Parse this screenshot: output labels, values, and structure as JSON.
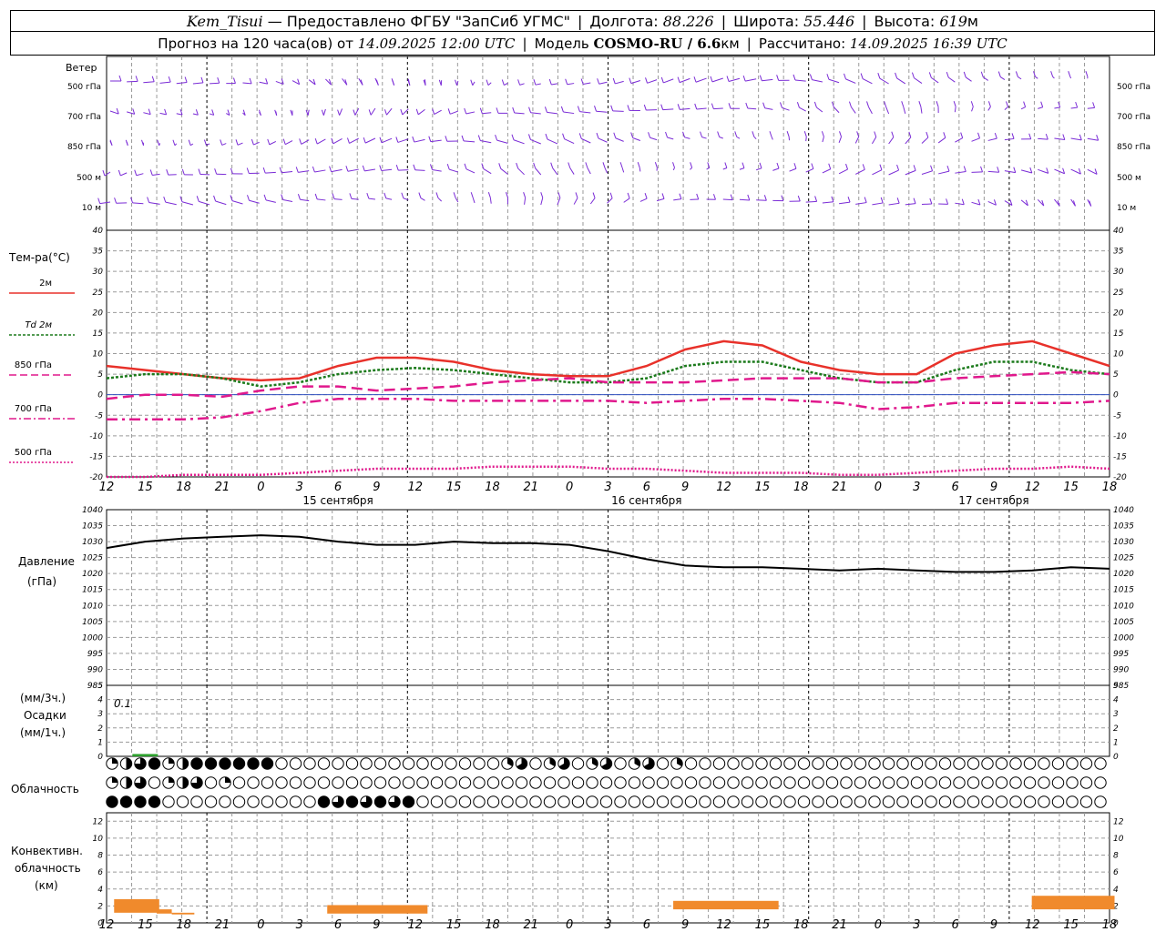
{
  "header": {
    "station": "Kem_Tisui",
    "provider": "— Предоставлено ФГБУ \"ЗапСиб УГМС\"",
    "lon_label": "Долгота:",
    "lon_value": "88.226",
    "lat_label": "Широта:",
    "lat_value": "55.446",
    "alt_label": "Высота:",
    "alt_value": "619",
    "alt_unit": "м",
    "forecast_prefix": "Прогноз на 120 часа(ов) от",
    "forecast_time": "14.09.2025 12:00 UTC",
    "model_label": "Модель",
    "model_name": "COSMO-RU / 6.6",
    "model_unit": "км",
    "calc_label": "Рассчитано:",
    "calc_time": "14.09.2025 16:39 UTC"
  },
  "wind_panel": {
    "title": "Ветер",
    "levels": [
      "500 гПа",
      "700 гПа",
      "850 гПа",
      "500 м",
      "10 м"
    ],
    "colors": {
      "barb": "#7a2bd6"
    }
  },
  "temp_panel": {
    "title": "Тем-ра(°С)",
    "legend": [
      "2м",
      "Td 2м",
      "850 гПа",
      "700 гПа",
      "500 гПа"
    ],
    "ticks": [
      40,
      35,
      30,
      25,
      20,
      15,
      10,
      5,
      0,
      -5,
      -10,
      -15,
      -20
    ]
  },
  "time_axis": {
    "hour_labels": [
      "12",
      "15",
      "18",
      "21",
      "0",
      "3",
      "6",
      "9",
      "12",
      "15",
      "18",
      "21",
      "0",
      "3",
      "6",
      "9",
      "12",
      "15",
      "18",
      "21",
      "0",
      "3",
      "6",
      "9",
      "12",
      "15",
      "18"
    ],
    "dates": [
      "15 сентября",
      "16 сентября",
      "17 сентября"
    ]
  },
  "pressure_panel": {
    "title": "Давление",
    "unit": "(гПа)",
    "ticks": [
      1040,
      1035,
      1030,
      1025,
      1020,
      1015,
      1010,
      1005,
      1000,
      995,
      990,
      985
    ]
  },
  "precip_panel": {
    "unit_top": "(мм/3ч.)",
    "title": "Осадки",
    "unit_bottom": "(мм/1ч.)",
    "ticks": [
      5,
      4,
      3,
      2,
      1,
      0
    ],
    "annotation": "0.1"
  },
  "cloud_panel": {
    "title": "Облачность"
  },
  "conv_panel": {
    "title_1": "Конвективн.",
    "title_2": "облачность",
    "unit": "(км)",
    "ticks": [
      12,
      10,
      8,
      6,
      4,
      2,
      0
    ]
  },
  "colors": {
    "t2m": "#e8312a",
    "td2m": "#1b7a1b",
    "t850": "#e0188c",
    "t700": "#e0188c",
    "t500": "#e0188c",
    "pressure": "#000000",
    "precip": "#2ca02c",
    "conv": "#f08a2c",
    "grid": "#9a9a9a"
  },
  "chart_data": [
    {
      "type": "line",
      "name": "temperature",
      "x": [
        12,
        15,
        18,
        21,
        0,
        3,
        6,
        9,
        12,
        15,
        18,
        21,
        0,
        3,
        6,
        9,
        12,
        15,
        18,
        21,
        0,
        3,
        6,
        9,
        12,
        15,
        18
      ],
      "ylim": [
        -20,
        40
      ],
      "series": [
        {
          "name": "2м",
          "values": [
            7,
            6,
            5,
            4,
            3.5,
            4,
            7,
            9,
            9,
            8,
            6,
            5,
            4.5,
            4.5,
            7,
            11,
            13,
            12,
            8,
            6,
            5,
            5,
            10,
            12,
            13,
            10,
            7
          ]
        },
        {
          "name": "Td 2м",
          "values": [
            4,
            5,
            5,
            4,
            2,
            3,
            5,
            6,
            6.5,
            6,
            5,
            4,
            3,
            3,
            4,
            7,
            8,
            8,
            6,
            4,
            3,
            3,
            6,
            8,
            8,
            6,
            5
          ]
        },
        {
          "name": "850 гПа",
          "values": [
            -1,
            0,
            0,
            -0.5,
            1,
            2,
            2,
            1,
            1.5,
            2,
            3,
            3.5,
            4,
            3,
            3,
            3,
            3.5,
            4,
            4,
            4,
            3,
            3,
            4,
            4.5,
            5,
            5.5,
            5
          ]
        },
        {
          "name": "700 гПа",
          "values": [
            -6,
            -6,
            -6,
            -5.5,
            -4,
            -2,
            -1,
            -1,
            -1,
            -1.5,
            -1.5,
            -1.5,
            -1.5,
            -1.5,
            -2,
            -1.5,
            -1,
            -1,
            -1.5,
            -2,
            -3.5,
            -3,
            -2,
            -2,
            -2,
            -2,
            -1.5
          ]
        },
        {
          "name": "500 гПа",
          "values": [
            -20,
            -20,
            -19.5,
            -19.5,
            -19.5,
            -19,
            -18.5,
            -18,
            -18,
            -18,
            -17.5,
            -17.5,
            -17.5,
            -18,
            -18,
            -18.5,
            -19,
            -19,
            -19,
            -19.5,
            -19.5,
            -19,
            -18.5,
            -18,
            -18,
            -17.5,
            -18
          ]
        }
      ]
    },
    {
      "type": "line",
      "name": "pressure",
      "x": [
        12,
        15,
        18,
        21,
        0,
        3,
        6,
        9,
        12,
        15,
        18,
        21,
        0,
        3,
        6,
        9,
        12,
        15,
        18,
        21,
        0,
        3,
        6,
        9,
        12,
        15,
        18
      ],
      "ylim": [
        985,
        1040
      ],
      "series": [
        {
          "name": "Давление",
          "values": [
            1028,
            1030,
            1031,
            1031.5,
            1032,
            1031.5,
            1030,
            1029,
            1029,
            1030,
            1029.5,
            1029.5,
            1029,
            1027,
            1024.5,
            1022.5,
            1022,
            1022,
            1021.5,
            1021,
            1021.5,
            1021,
            1020.5,
            1020.5,
            1021,
            1022,
            1021.5
          ]
        }
      ]
    },
    {
      "type": "bar",
      "name": "precipitation",
      "ylim": [
        0,
        5
      ],
      "x": [
        15
      ],
      "values": [
        0.1
      ]
    },
    {
      "type": "bar",
      "name": "convective_cloud",
      "ylim": [
        0,
        13
      ],
      "bars": [
        {
          "x_from": 12,
          "x_to": 18,
          "bottom": 1,
          "top": 3
        },
        {
          "x_from": 18,
          "x_to": 21,
          "bottom": 1,
          "top": 1.2
        },
        {
          "x_from": 3,
          "x_to": 12,
          "bottom": 1,
          "top": 2
        },
        {
          "x_from": 5,
          "x_to": 12,
          "bottom": 1.5,
          "top": 2.5
        },
        {
          "x_from": 3,
          "x_to": 12,
          "bottom": 1.5,
          "top": 3.2
        }
      ]
    }
  ]
}
